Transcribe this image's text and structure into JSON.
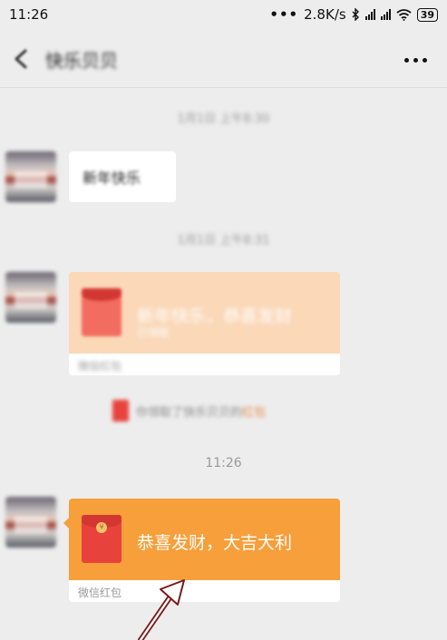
{
  "status": {
    "time": "11:26",
    "dots": "•••",
    "speed": "2.8K/s",
    "bluetooth_icon": "bluetooth-icon",
    "wifi_icon": "wifi-icon",
    "battery": "39"
  },
  "header": {
    "title": "快乐贝贝",
    "back_icon": "chevron-left-icon",
    "more_icon": "more-dots-icon"
  },
  "chat": {
    "time_1": "1月1日 上午8:30",
    "msg_1": "新年快乐",
    "time_2": "1月1日 上午8:31",
    "packet_1": {
      "title": "新年快乐，恭喜发财",
      "sub": "已领取",
      "footer": "微信红包"
    },
    "notice": {
      "text": "你领取了快乐贝贝的",
      "link": "红包"
    },
    "time_3": "11:26",
    "packet_2": {
      "title": "恭喜发财，大吉大利",
      "footer": "微信红包"
    }
  },
  "colors": {
    "red_packet": "#f79f3b",
    "red_packet_opened": "#fad8b8",
    "arrow": "#8a1f1f"
  }
}
